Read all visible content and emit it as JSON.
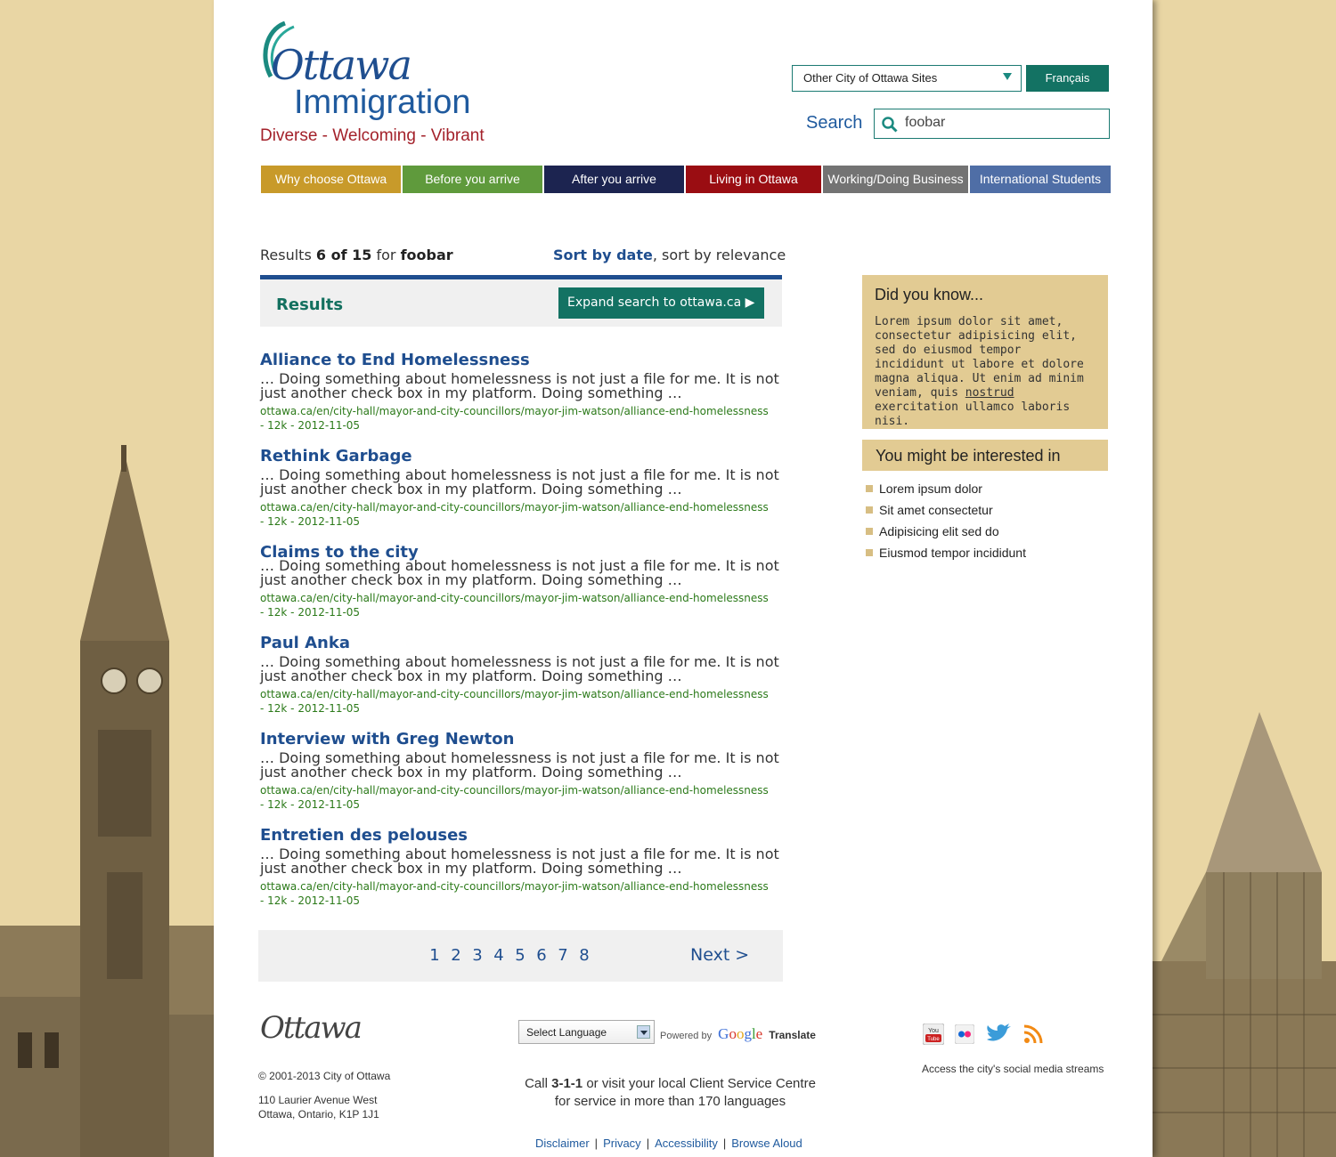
{
  "header": {
    "logo_word": "Ottawa",
    "logo_sub": "Immigration",
    "logo_tagline": "Diverse - Welcoming - Vibrant",
    "sites_select": "Other City of Ottawa Sites",
    "lang_button": "Français",
    "search_label": "Search",
    "search_value": "foobar"
  },
  "nav": [
    {
      "label": "Why choose Ottawa",
      "color": "#c89a2a"
    },
    {
      "label": "Before you arrive",
      "color": "#5f9a3c"
    },
    {
      "label": "After you arrive",
      "color": "#1c2450"
    },
    {
      "label": "Living in Ottawa",
      "color": "#9a0d12"
    },
    {
      "label": "Working/Doing Business",
      "color": "#737373"
    },
    {
      "label": "International Students",
      "color": "#4f6ea6"
    }
  ],
  "summary": {
    "prefix": "Results",
    "range": "6 of 15",
    "for": "for",
    "query": "foobar",
    "sort_active": "Sort by date",
    "sort_other": ", sort by relevance"
  },
  "results_bar": {
    "title": "Results",
    "expand": "Expand search to ottawa.ca ▶"
  },
  "results": [
    {
      "title": "Alliance to End Homelessness",
      "snippet": "… Doing something about homelessness is not just a file for me. It is not just another check box in my platform. Doing something …",
      "url": "ottawa.ca/en/city-hall/mayor-and-city-councillors/mayor-jim-watson/alliance-end-homelessness",
      "meta": "- 12k - 2012-11-05"
    },
    {
      "title": "Rethink Garbage",
      "snippet": "… Doing something about homelessness is not just a file for me. It is not just another check box in my platform. Doing something …",
      "url": "ottawa.ca/en/city-hall/mayor-and-city-councillors/mayor-jim-watson/alliance-end-homelessness",
      "meta": "- 12k - 2012-11-05"
    },
    {
      "title": "Claims to the city",
      "snippet": "… Doing something about homelessness is not just a file for me. It is not just another check box in my platform. Doing something …",
      "url": "ottawa.ca/en/city-hall/mayor-and-city-councillors/mayor-jim-watson/alliance-end-homelessness",
      "meta": "- 12k - 2012-11-05"
    },
    {
      "title": "Paul Anka",
      "snippet": "… Doing something about homelessness is not just a file for me. It is not just another check box in my platform. Doing something …",
      "url": "ottawa.ca/en/city-hall/mayor-and-city-councillors/mayor-jim-watson/alliance-end-homelessness",
      "meta": "- 12k - 2012-11-05"
    },
    {
      "title": "Interview with Greg Newton",
      "snippet": "… Doing something about homelessness is not just a file for me. It is not just another check box in my platform. Doing something …",
      "url": "ottawa.ca/en/city-hall/mayor-and-city-councillors/mayor-jim-watson/alliance-end-homelessness",
      "meta": "- 12k - 2012-11-05"
    },
    {
      "title": "Entretien des pelouses",
      "snippet": "… Doing something about homelessness is not just a file for me. It is not just another check box in my platform. Doing something …",
      "url": "ottawa.ca/en/city-hall/mayor-and-city-councillors/mayor-jim-watson/alliance-end-homelessness",
      "meta": "- 12k - 2012-11-05"
    }
  ],
  "pager": {
    "pages": [
      "1",
      "2",
      "3",
      "4",
      "5",
      "6",
      "7",
      "8"
    ],
    "next": "Next >"
  },
  "sidebar": {
    "dyk_title": "Did you know...",
    "dyk_text_a": "Lorem ipsum dolor sit amet, consectetur adipisicing elit, sed do eiusmod tempor incididunt ut labore et dolore magna aliqua. Ut enim ad minim veniam, quis ",
    "dyk_link": "nostrud",
    "dyk_text_b": " exercitation ullamco laboris nisi.",
    "interest_title": "You might be interested in",
    "interest_items": [
      "Lorem ipsum dolor",
      "Sit amet consectetur",
      "Adipisicing elit sed do",
      "Eiusmod tempor incididunt"
    ]
  },
  "footer": {
    "logo": "Ottawa",
    "copyright": "© 2001-2013 City of Ottawa",
    "address_1": "110 Laurier Avenue West",
    "address_2": "Ottawa, Ontario, K1P 1J1",
    "select_language": "Select Language",
    "powered_by": "Powered by",
    "google": "Google",
    "translate": "Translate",
    "call_1": "Call",
    "call_num": "3-1-1",
    "call_2": "or visit your local Client Service Centre",
    "call_3": "for service in more than 170 languages",
    "links": [
      "Disclaimer",
      "Privacy",
      "Accessibility",
      "Browse Aloud"
    ],
    "social_caption": "Access the city's social media streams",
    "social_icons": [
      "youtube-icon",
      "flickr-icon",
      "twitter-icon",
      "rss-icon"
    ]
  }
}
